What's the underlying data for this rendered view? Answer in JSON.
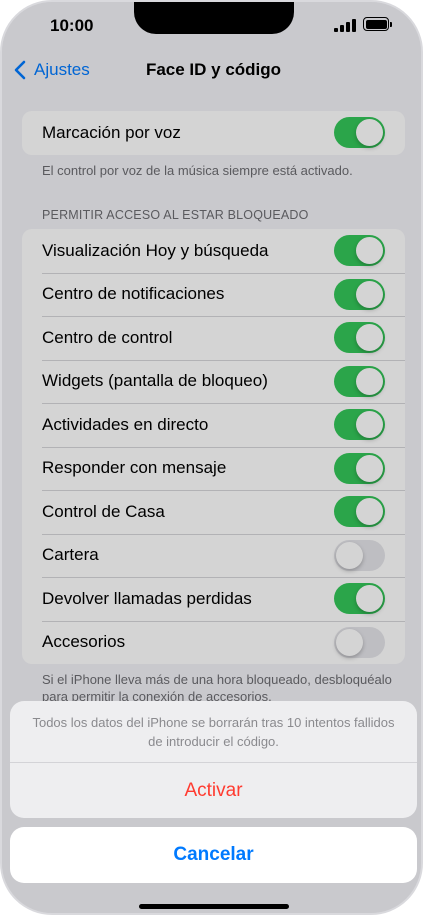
{
  "status": {
    "time": "10:00"
  },
  "nav": {
    "back_label": "Ajustes",
    "title": "Face ID y código"
  },
  "voice": {
    "label": "Marcación por voz",
    "on": true,
    "footnote": "El control por voz de la música siempre está activado."
  },
  "locked_access": {
    "header": "PERMITIR ACCESO AL ESTAR BLOQUEADO",
    "items": [
      {
        "label": "Visualización Hoy y búsqueda",
        "on": true
      },
      {
        "label": "Centro de notificaciones",
        "on": true
      },
      {
        "label": "Centro de control",
        "on": true
      },
      {
        "label": "Widgets (pantalla de bloqueo)",
        "on": true
      },
      {
        "label": "Actividades en directo",
        "on": true
      },
      {
        "label": "Responder con mensaje",
        "on": true
      },
      {
        "label": "Control de Casa",
        "on": true
      },
      {
        "label": "Cartera",
        "on": false
      },
      {
        "label": "Devolver llamadas perdidas",
        "on": true
      },
      {
        "label": "Accesorios",
        "on": false
      }
    ],
    "footnote": "Si el iPhone lleva más de una hora bloqueado, desbloquéalo para permitir la conexión de accesorios."
  },
  "action_sheet": {
    "message": "Todos los datos del iPhone se borrarán tras 10 intentos fallidos de introducir el código.",
    "action_label": "Activar",
    "cancel_label": "Cancelar"
  },
  "colors": {
    "accent": "#007aff",
    "toggle_on": "#34c759",
    "destructive": "#ff3b30"
  }
}
